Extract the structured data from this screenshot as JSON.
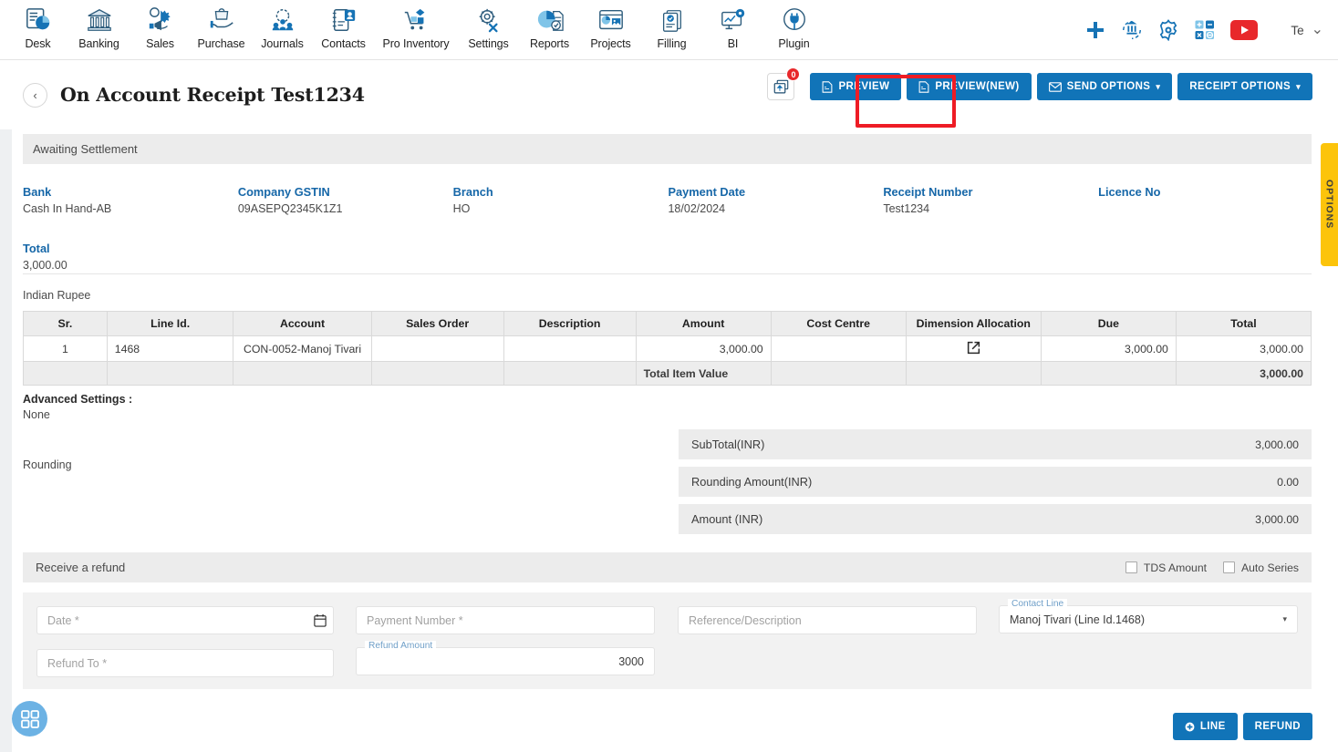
{
  "topnav": {
    "items": [
      {
        "label": "Desk",
        "icon": "desk-dashboard-icon"
      },
      {
        "label": "Banking",
        "icon": "bank-building-icon"
      },
      {
        "label": "Sales",
        "icon": "sales-megaphone-icon"
      },
      {
        "label": "Purchase",
        "icon": "purchase-hand-bag-icon"
      },
      {
        "label": "Journals",
        "icon": "journals-gear-people-icon"
      },
      {
        "label": "Contacts",
        "icon": "contacts-book-icon"
      },
      {
        "label": "Pro Inventory",
        "icon": "inventory-cart-icon"
      },
      {
        "label": "Settings",
        "icon": "settings-gear-tools-icon"
      },
      {
        "label": "Reports",
        "icon": "reports-pie-chart-icon"
      },
      {
        "label": "Projects",
        "icon": "projects-window-icon"
      },
      {
        "label": "Filling",
        "icon": "filling-documents-icon"
      },
      {
        "label": "BI",
        "icon": "bi-monitor-icon"
      },
      {
        "label": "Plugin",
        "icon": "plugin-plug-icon"
      }
    ],
    "right_icons": [
      {
        "name": "add-plus-icon",
        "color": "#1673b5"
      },
      {
        "name": "bank-sync-icon",
        "color": "#1673b5"
      },
      {
        "name": "settings-gear-icon",
        "color": "#1673b5"
      },
      {
        "name": "calculator-icon",
        "color": "#1673b5"
      },
      {
        "name": "youtube-icon",
        "color": "#e8282b"
      }
    ],
    "user": {
      "label": "Te",
      "chevron": "⌄"
    }
  },
  "header": {
    "back_label": "‹",
    "title": "On Account Receipt Test1234",
    "upload_icon": "upload-export-icon",
    "upload_badge": "0",
    "buttons": [
      {
        "label": "PREVIEW",
        "icon": "pdf-file-icon",
        "highlighted": true
      },
      {
        "label": "PREVIEW(NEW)",
        "icon": "pdf-file-icon",
        "highlighted": false
      },
      {
        "label": "SEND OPTIONS",
        "icon": "envelope-icon",
        "caret": "▾",
        "highlighted": false
      },
      {
        "label": "RECEIPT OPTIONS",
        "icon": "",
        "caret": "▾",
        "highlighted": false
      }
    ],
    "highlight_color": "#ee1c25"
  },
  "status": {
    "text": "Awaiting Settlement"
  },
  "options_tab": {
    "label": "OPTIONS",
    "color": "#fcc40b"
  },
  "summary": {
    "row1": [
      {
        "label": "Bank",
        "value": "Cash In Hand-AB"
      },
      {
        "label": "Company GSTIN",
        "value": "09ASEPQ2345K1Z1"
      },
      {
        "label": "Branch",
        "value": "HO"
      },
      {
        "label": "Payment Date",
        "value": "18/02/2024"
      },
      {
        "label": "Receipt Number",
        "value": "Test1234"
      },
      {
        "label": "Licence No",
        "value": ""
      }
    ],
    "row2": [
      {
        "label": "Total",
        "value": "3,000.00"
      }
    ]
  },
  "currency_label": "Indian Rupee",
  "items_table": {
    "columns": [
      "Sr.",
      "Line Id.",
      "Account",
      "Sales Order",
      "Description",
      "Amount",
      "Cost Centre",
      "Dimension Allocation",
      "Due",
      "Total"
    ],
    "rows": [
      {
        "sr": "1",
        "line_id": "1468",
        "account": "CON-0052-Manoj Tivari",
        "sales_order": "",
        "description": "",
        "amount": "3,000.00",
        "cost_centre": "",
        "dimension_allocation_icon": "external-link-icon",
        "due": "3,000.00",
        "total": "3,000.00"
      }
    ],
    "footer": {
      "label": "Total Item Value",
      "total": "3,000.00"
    }
  },
  "advanced_settings": {
    "title": "Advanced Settings :",
    "value": "None"
  },
  "rounding_label": "Rounding",
  "totals": [
    {
      "label": "SubTotal(INR)",
      "value": "3,000.00"
    },
    {
      "label": "Rounding Amount(INR)",
      "value": "0.00"
    },
    {
      "label": "Amount (INR)",
      "value": "3,000.00"
    }
  ],
  "refund": {
    "title": "Receive a refund",
    "checkboxes": [
      {
        "label": "TDS Amount",
        "checked": false
      },
      {
        "label": "Auto Series",
        "checked": false
      }
    ],
    "fields": {
      "date": {
        "placeholder": "Date *",
        "value": "",
        "calendar_icon": "calendar-icon"
      },
      "payment_number": {
        "placeholder": "Payment Number *",
        "value": ""
      },
      "reference": {
        "placeholder": "Reference/Description",
        "value": ""
      },
      "contact_line": {
        "label": "Contact Line",
        "value": "Manoj Tivari (Line Id.1468)",
        "caret": "▾"
      },
      "refund_to": {
        "placeholder": "Refund To *",
        "value": ""
      },
      "refund_amount": {
        "label": "Refund Amount",
        "value": "3000"
      }
    }
  },
  "bottom": {
    "buttons": [
      {
        "label": "LINE",
        "icon": "plus-circle-icon"
      },
      {
        "label": "REFUND",
        "icon": ""
      }
    ],
    "fab": {
      "icon": "grid-apps-icon",
      "color": "#6cb2e4"
    }
  }
}
